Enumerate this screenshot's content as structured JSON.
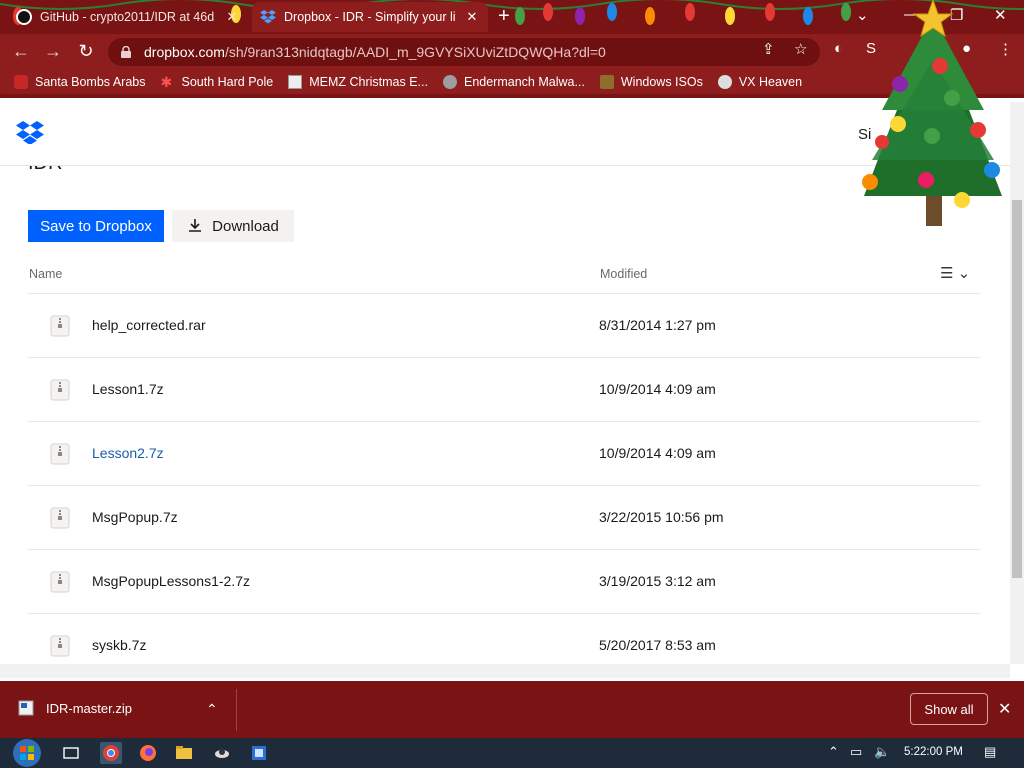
{
  "browser": {
    "tabs": [
      {
        "title": "GitHub - crypto2011/IDR at 46d",
        "active": false
      },
      {
        "title": "Dropbox - IDR - Simplify your lif",
        "active": true
      }
    ],
    "url_host": "dropbox.com",
    "url_path": "/sh/9ran313nidqtagb/AADI_m_9GVYSiXUviZtDQWQHa?dl=0",
    "bookmarks": [
      {
        "label": "Santa Bombs Arabs",
        "icon": "sleigh-icon"
      },
      {
        "label": "South Hard Pole",
        "icon": "snowflake-icon"
      },
      {
        "label": "MEMZ Christmas E...",
        "icon": "memz-icon"
      },
      {
        "label": "Endermanch Malwa...",
        "icon": "raccoon-icon"
      },
      {
        "label": "Windows ISOs",
        "icon": "windows-iso-icon"
      },
      {
        "label": "VX Heaven",
        "icon": "vx-heaven-icon"
      }
    ]
  },
  "page": {
    "signin_label": "Si",
    "folder_title": "IDR",
    "save_button": "Save to Dropbox",
    "download_button": "Download",
    "columns": {
      "name": "Name",
      "modified": "Modified"
    },
    "files": [
      {
        "name": "help_corrected.rar",
        "modified": "8/31/2014 1:27 pm"
      },
      {
        "name": "Lesson1.7z",
        "modified": "10/9/2014 4:09 am"
      },
      {
        "name": "Lesson2.7z",
        "modified": "10/9/2014 4:09 am"
      },
      {
        "name": "MsgPopup.7z",
        "modified": "3/22/2015 10:56 pm"
      },
      {
        "name": "MsgPopupLessons1-2.7z",
        "modified": "3/19/2015 3:12 am"
      },
      {
        "name": "syskb.7z",
        "modified": "5/20/2017 8:53 am"
      }
    ]
  },
  "downloads": {
    "file": "IDR-master.zip",
    "show_all": "Show all"
  },
  "taskbar": {
    "clock": "5:22:00 PM"
  },
  "colors": {
    "chrome_frame": "#7a1414",
    "toolbar": "#8e1d1d",
    "dropbox_blue": "#0061fe",
    "taskbar": "#1d2b3a"
  }
}
